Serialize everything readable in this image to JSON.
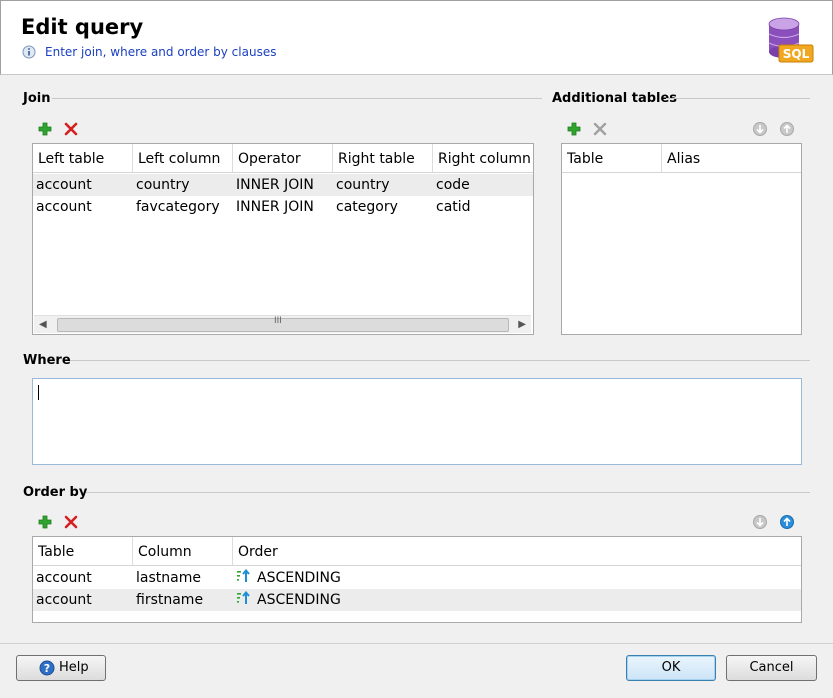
{
  "header": {
    "title": "Edit query",
    "subtitle": "Enter join, where and order by clauses",
    "logo_text": "SQL"
  },
  "join": {
    "label": "Join",
    "columns": [
      "Left table",
      "Left column",
      "Operator",
      "Right table",
      "Right column"
    ],
    "rows": [
      [
        "account",
        "country",
        "INNER JOIN",
        "country",
        "code"
      ],
      [
        "account",
        "favcategory",
        "INNER JOIN",
        "category",
        "catid"
      ]
    ],
    "scroll_grip": "III"
  },
  "additional_tables": {
    "label": "Additional tables",
    "columns": [
      "Table",
      "Alias"
    ]
  },
  "where": {
    "label": "Where",
    "value": ""
  },
  "order_by": {
    "label": "Order by",
    "columns": [
      "Table",
      "Column",
      "Order"
    ],
    "rows": [
      [
        "account",
        "lastname",
        "ASCENDING"
      ],
      [
        "account",
        "firstname",
        "ASCENDING"
      ]
    ]
  },
  "buttons": {
    "help": "Help",
    "ok": "OK",
    "cancel": "Cancel"
  },
  "colors": {
    "add_green": "#2ea52e",
    "remove_red": "#d42020",
    "link_blue": "#1a3fbf",
    "order_blue": "#1e8fd6"
  }
}
